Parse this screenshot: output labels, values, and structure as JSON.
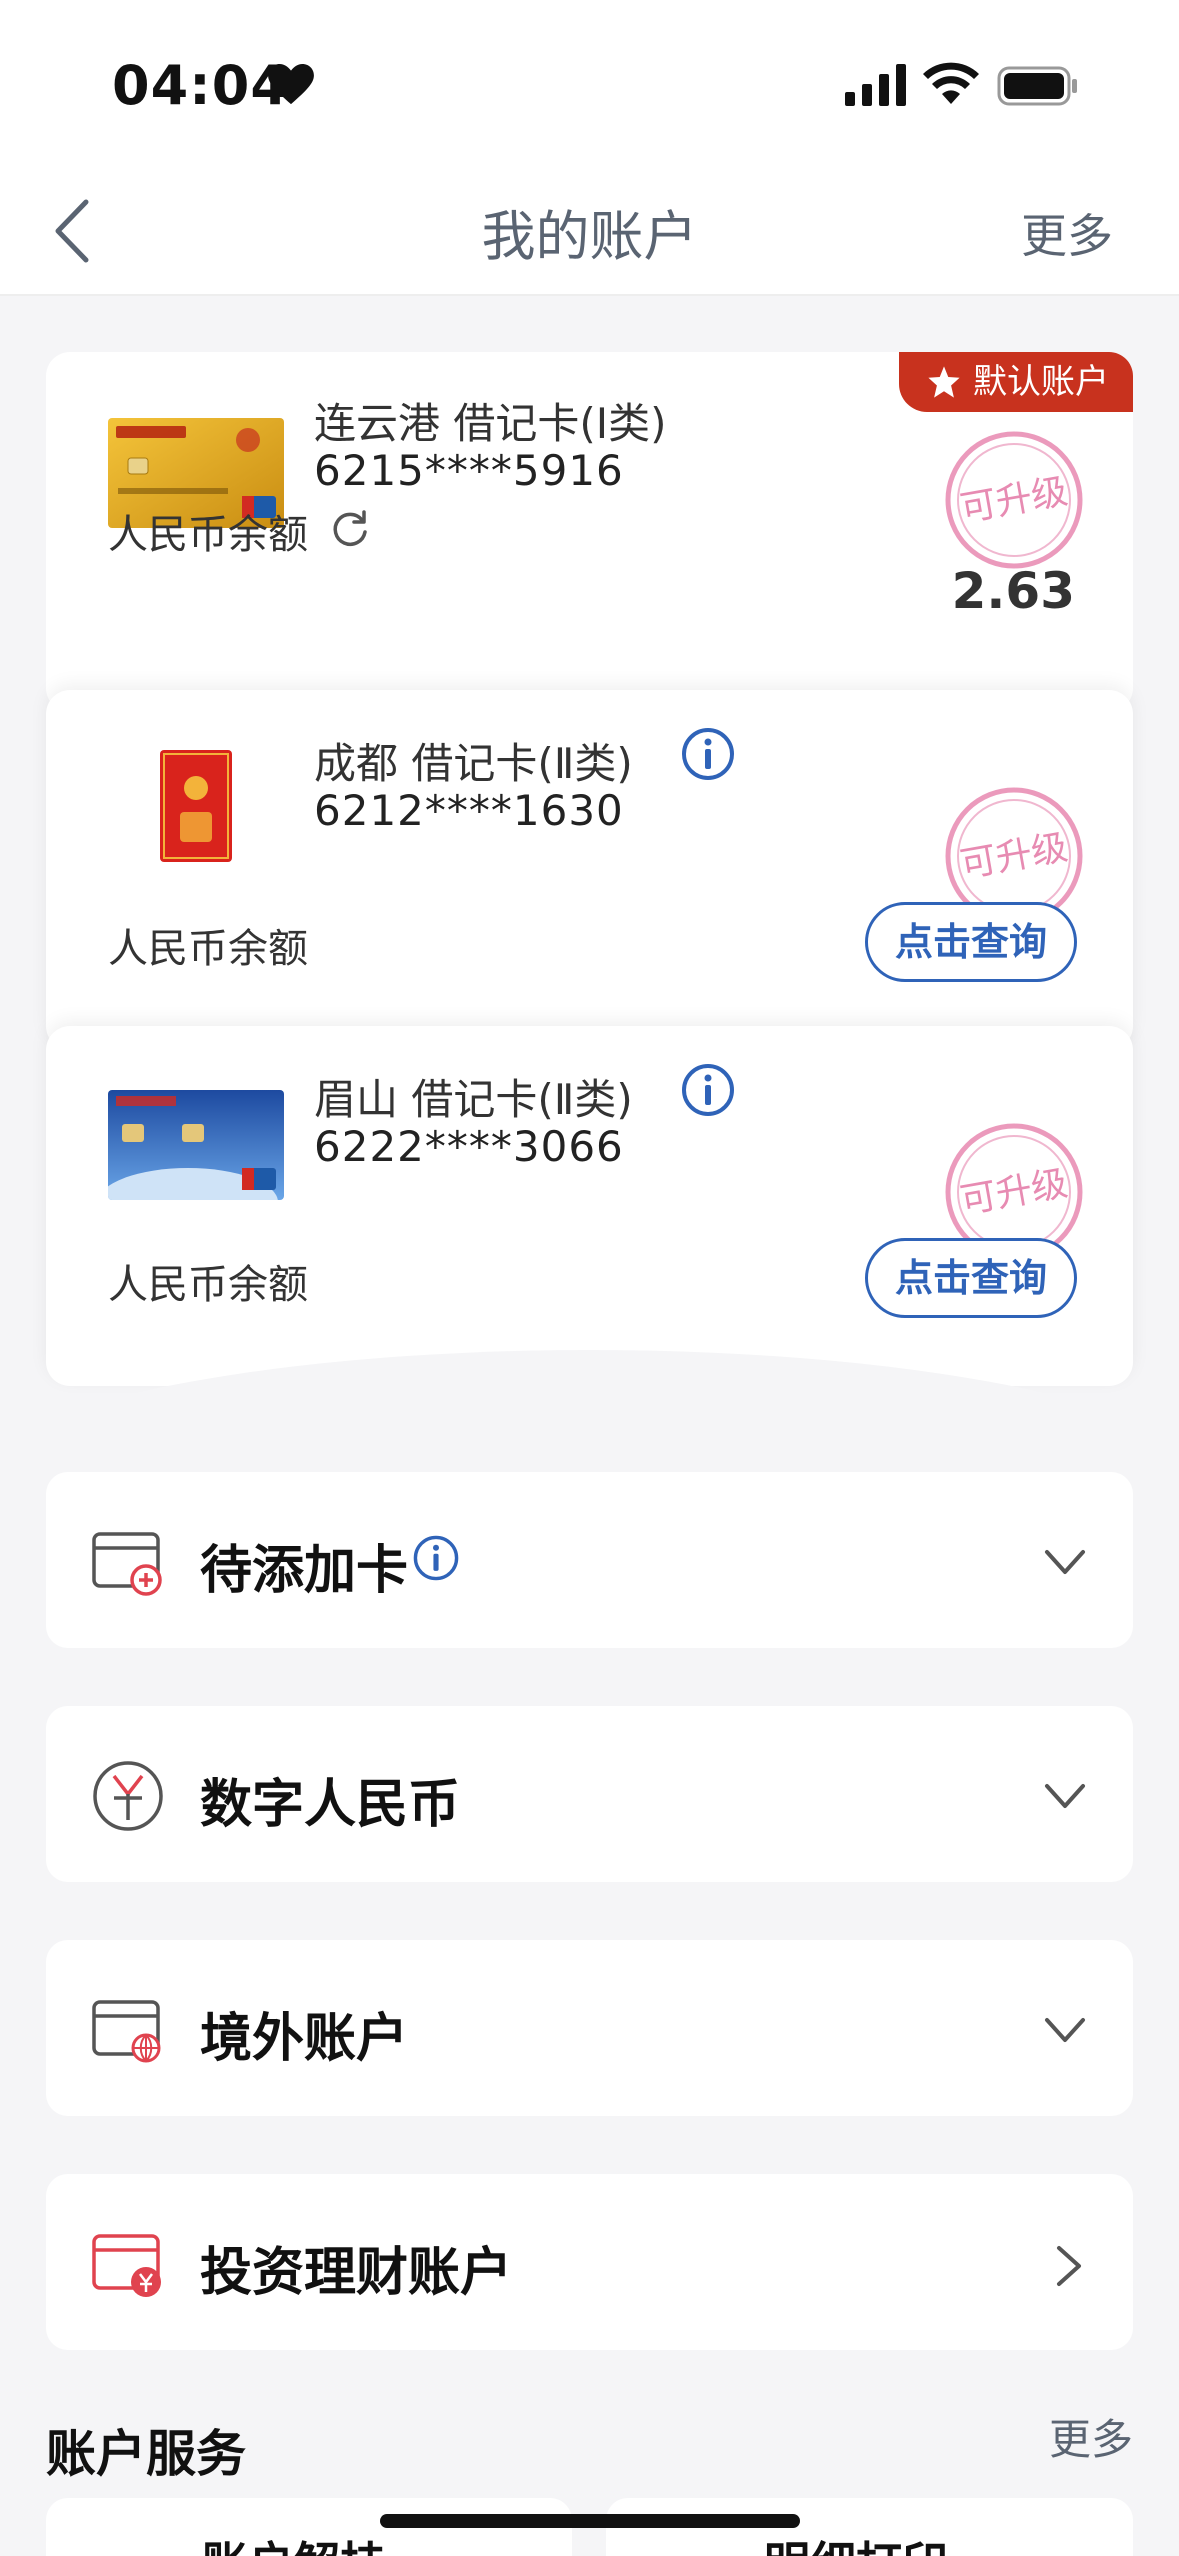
{
  "status": {
    "time": "04:04"
  },
  "nav": {
    "title": "我的账户",
    "more": "更多"
  },
  "accounts": [
    {
      "name": "连云港 借记卡(Ⅰ类)",
      "number": "6215****5916",
      "balance_label": "人民币余额",
      "balance": "2.63",
      "badge": "默认账户",
      "stamp": "可升级"
    },
    {
      "name": "成都 借记卡(Ⅱ类)",
      "number": "6212****1630",
      "balance_label": "人民币余额",
      "query": "点击查询",
      "stamp": "可升级"
    },
    {
      "name": "眉山 借记卡(Ⅱ类)",
      "number": "6222****3066",
      "balance_label": "人民币余额",
      "query": "点击查询",
      "stamp": "可升级"
    }
  ],
  "sections": [
    {
      "title": "待添加卡",
      "icon": "card-add-icon"
    },
    {
      "title": "数字人民币",
      "icon": "digital-rmb-icon"
    },
    {
      "title": "境外账户",
      "icon": "card-globe-icon"
    },
    {
      "title": "投资理财账户",
      "icon": "card-yen-icon"
    }
  ],
  "services": {
    "title": "账户服务",
    "more": "更多",
    "items": [
      "账户解挂",
      "明细打印"
    ]
  },
  "colors": {
    "accent": "#2f63b8",
    "badge": "#c8321e",
    "stamp": "#e26fa0"
  }
}
